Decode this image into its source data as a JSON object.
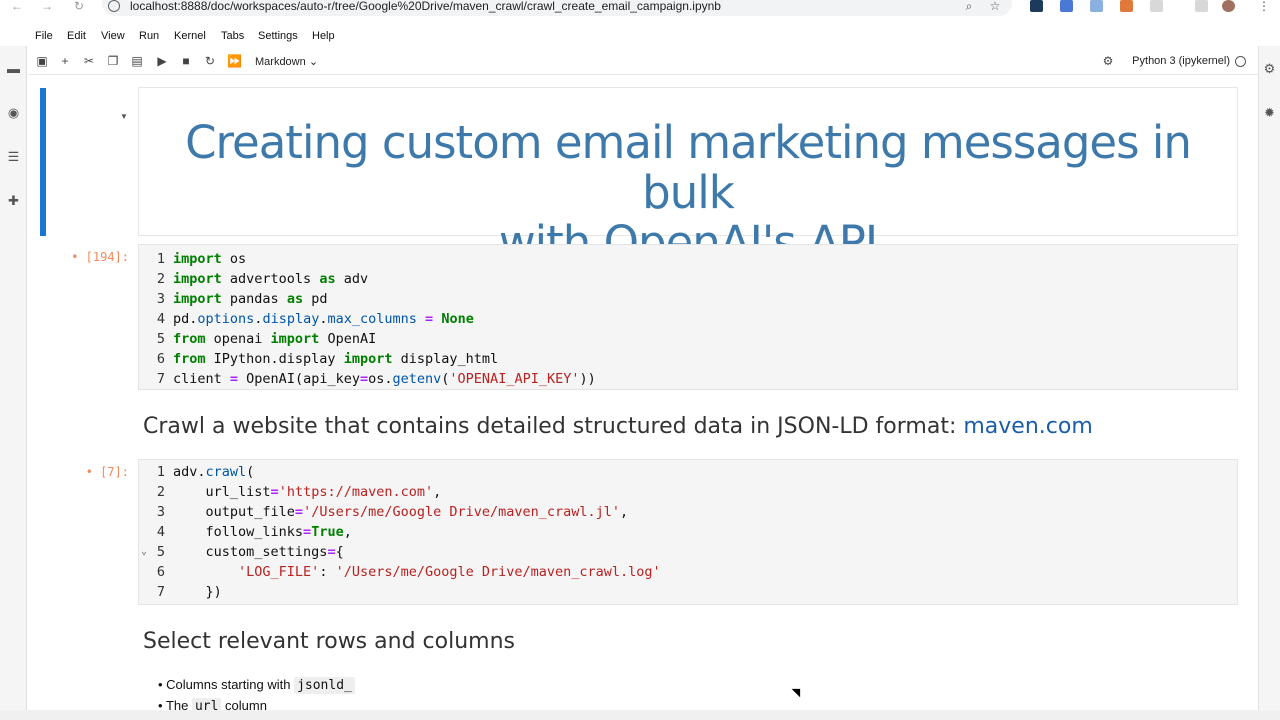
{
  "browser": {
    "url": "localhost:8888/doc/workspaces/auto-r/tree/Google%20Drive/maven_crawl/crawl_create_email_campaign.ipynb"
  },
  "menu": [
    "File",
    "Edit",
    "View",
    "Run",
    "Kernel",
    "Tabs",
    "Settings",
    "Help"
  ],
  "toolbar": {
    "cell_type": "Markdown",
    "kernel": "Python 3 (ipykernel)"
  },
  "cells": {
    "title": {
      "line1": "Creating custom email marketing messages in bulk",
      "line2": "with OpenAI's API"
    },
    "code1": {
      "prompt": "[194]:",
      "lines": [
        "import os",
        "import advertools as adv",
        "import pandas as pd",
        "pd.options.display.max_columns = None",
        "from openai import OpenAI",
        "from IPython.display import display_html",
        "client = OpenAI(api_key=os.getenv('OPENAI_API_KEY'))"
      ]
    },
    "h2_crawl": {
      "text": "Crawl a website that contains detailed structured data in JSON-LD format: ",
      "link": "maven.com"
    },
    "code2": {
      "prompt": "[7]:",
      "lines": [
        "adv.crawl(",
        "    url_list='https://maven.com',",
        "    output_file='/Users/me/Google Drive/maven_crawl.jl',",
        "    follow_links=True,",
        "    custom_settings={",
        "        'LOG_FILE': '/Users/me/Google Drive/maven_crawl.log'",
        "    })"
      ]
    },
    "h2_select": {
      "text": "Select relevant rows and columns"
    },
    "bullets": [
      {
        "text": "Columns starting with ",
        "code": "jsonld_"
      },
      {
        "text": "The ",
        "code": "url",
        "tail": " column"
      }
    ]
  },
  "colors": {
    "heading_blue": "#3d79aa",
    "active_cell": "#1976d2",
    "prompt": "#f08a5d",
    "keyword": "#008000",
    "string": "#ba2121"
  }
}
